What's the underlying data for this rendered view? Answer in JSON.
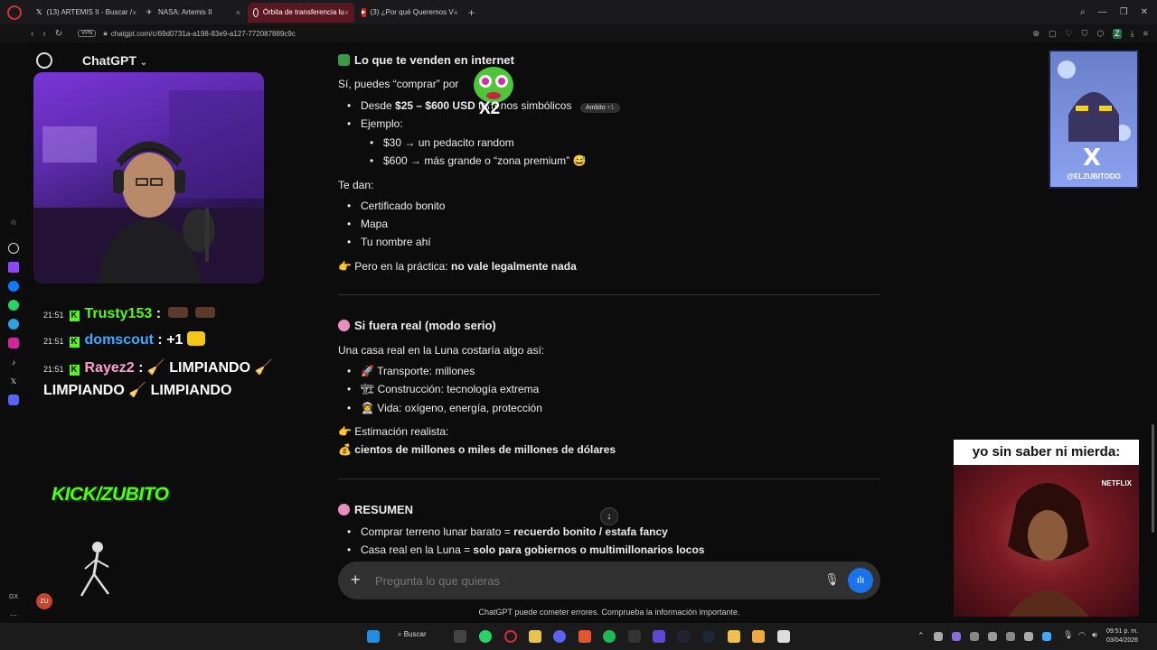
{
  "browser": {
    "tabs": [
      {
        "label": "(13) ARTEMIS II - Buscar /",
        "icon": "x-icon",
        "active": false
      },
      {
        "label": "NASA: Artemis II",
        "icon": "nasa-icon",
        "active": false
      },
      {
        "label": "Órbita de transferencia lu",
        "icon": "chatgpt-icon",
        "active": true
      },
      {
        "label": "(3) ¿Por qué Queremos V",
        "icon": "youtube-icon",
        "active": false
      }
    ],
    "vpn_label": "VPN",
    "url": "chatgpt.com/c/69d0731a-a198-83e9-a127-772087889c9c",
    "profile_badge": "Z"
  },
  "gpt": {
    "model": "ChatGPT",
    "sections": {
      "s1_title": "Lo que te venden en internet",
      "s1_intro_a": "Sí, puedes “comprar” por ",
      "s1_b1_a": "Desde ",
      "s1_b1_bold": "$25 – $600 USD",
      "s1_b1_b": " terrenos simbólicos",
      "s1_b1_chip": "Ambito",
      "s1_b1_chip_count": "+1",
      "s1_b2": "Ejemplo:",
      "s1_b2a": "$30 → un pedacito random",
      "s1_b2b": "$600 → más grande o “zona premium”",
      "s1_te_dan": "Te dan:",
      "s1_list": [
        "Certificado bonito",
        "Mapa",
        "Tu nombre ahí"
      ],
      "s1_practice_a": "Pero en la práctica: ",
      "s1_practice_bold": "no vale legalmente nada",
      "s2_title": "Si fuera real (modo serio)",
      "s2_intro": "Una casa real en la Luna costaría algo así:",
      "s2_list": [
        "Transporte: millones",
        "Construcción: tecnología extrema",
        "Vida: oxígeno, energía, protección"
      ],
      "s2_estimate": "Estimación realista:",
      "s2_estimate_bold": "cientos de millones o miles de millones de dólares",
      "s3_title": "RESUMEN",
      "s3_b1_a": "Comprar terreno lunar barato = ",
      "s3_b1_bold": "recuerdo bonito / estafa fancy",
      "s3_b2_a": "Casa real en la Luna = ",
      "s3_b2_bold": "solo para gobiernos o multimillonarios locos"
    },
    "composer_placeholder": "Pregunta lo que quieras",
    "footnote": "ChatGPT puede cometer errores. Comprueba la información importante."
  },
  "stream": {
    "chat": [
      {
        "time": "21:51",
        "user": "Trusty153",
        "msg": " : ",
        "user_color": "#53fc18"
      },
      {
        "time": "21:51",
        "user": "domscout",
        "msg": " : +1 ",
        "user_color": "#3fa9ff"
      },
      {
        "time": "21:51",
        "user": "Rayez2",
        "msg": " : ",
        "user_color": "#ff9ecf"
      }
    ],
    "rayez_text_1": "LIMPIANDO",
    "rayez_text_2": "LIMPIANDO",
    "rayez_text_3": "LIMPIANDO",
    "kick_logo": "KICK/ZUBITO",
    "overlay_sticker": "X2",
    "meme_caption": "yo sin saber ni mierda:",
    "meme_tag": "NETFLIX",
    "x_card_handle": "@ELZUBITODO",
    "sidebar_tag": "GX",
    "avatar_initials": "ZU"
  },
  "taskbar": {
    "search_label": "Buscar",
    "time": "09:51 p. m.",
    "date": "03/04/2026"
  },
  "colors": {
    "accent_blue": "#1a73e8",
    "kick_green": "#53fc18",
    "active_tab": "#5b1720"
  }
}
